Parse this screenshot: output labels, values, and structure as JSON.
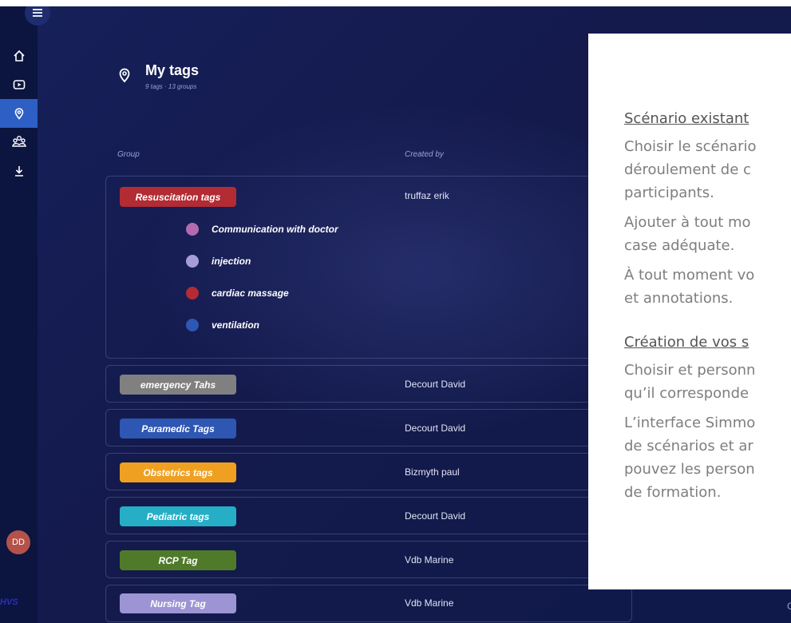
{
  "sidebar": {
    "menu_icon": "hamburger-icon",
    "items": [
      {
        "icon": "home-icon"
      },
      {
        "icon": "video-icon"
      },
      {
        "icon": "map-pin-icon",
        "active": true
      },
      {
        "icon": "user-group-icon"
      },
      {
        "icon": "download-icon"
      }
    ],
    "avatar_initials": "DD",
    "brand": "HVS"
  },
  "header": {
    "title": "My tags",
    "subtitle": "9 tags · 13 groups"
  },
  "table": {
    "columns": {
      "group": "Group",
      "created_by": "Created by"
    },
    "groups": [
      {
        "name": "Resuscitation tags",
        "color": "#b32b33",
        "creator": "truffaz erik",
        "tags": [
          {
            "label": "Communication with doctor",
            "color": "#b36bb0"
          },
          {
            "label": "injection",
            "color": "#a59ed6"
          },
          {
            "label": "cardiac massage",
            "color": "#b32b33"
          },
          {
            "label": "ventilation",
            "color": "#2e56b3"
          }
        ]
      },
      {
        "name": "emergency Tahs",
        "color": "#808080",
        "creator": "Decourt David"
      },
      {
        "name": "Paramedic Tags",
        "color": "#2e56b3",
        "creator": "Decourt David"
      },
      {
        "name": "Obstetrics tags",
        "color": "#f0a020",
        "creator": "Bizmyth paul"
      },
      {
        "name": "Pediatric tags",
        "color": "#25aec6",
        "creator": "Decourt David"
      },
      {
        "name": "RCP Tag",
        "color": "#4f7a2a",
        "creator": "Vdb Marine"
      },
      {
        "name": "Nursing Tag",
        "color": "#9d94d4",
        "creator": "Vdb Marine"
      }
    ],
    "edge_char": "C"
  },
  "overlay": {
    "section1": {
      "heading": "Scénario existant",
      "lines": [
        "Choisir le scénario",
        "déroulement de c",
        "participants.",
        "Ajouter à tout mo",
        "case adéquate.",
        "À tout moment vo",
        "et annotations."
      ]
    },
    "section2": {
      "heading": "Création de vos s",
      "lines": [
        "Choisir et personn",
        "qu’il corresponde",
        "L’interface Simmo",
        "de scénarios et ar",
        "pouvez les person",
        "de formation."
      ]
    }
  }
}
